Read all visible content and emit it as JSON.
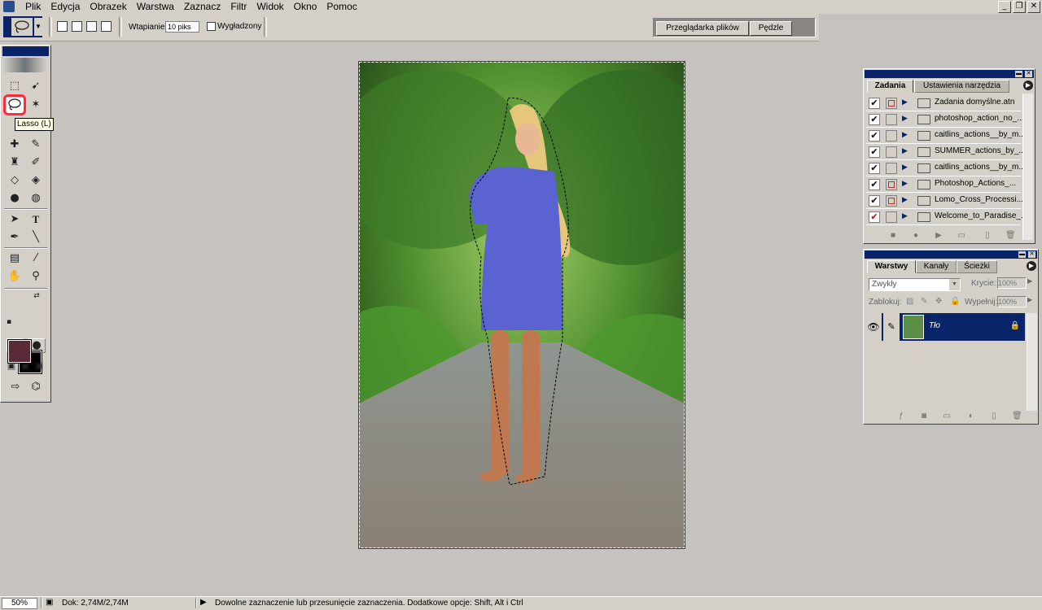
{
  "menubar": {
    "items": [
      "Plik",
      "Edycja",
      "Obrazek",
      "Warstwa",
      "Zaznacz",
      "Filtr",
      "Widok",
      "Okno",
      "Pomoc"
    ],
    "window_buttons": [
      "_",
      "❐",
      "✕"
    ]
  },
  "options_bar": {
    "feather_label": "Wtapianie",
    "feather_value": "10 piks",
    "antialias_label": "Wygładzony",
    "well_tabs": [
      "Przeglądarka plików",
      "Pędzle"
    ]
  },
  "toolbox": {
    "tooltip": "Lasso (L)",
    "fg_color": "#5a2a36",
    "bg_color": "#000000"
  },
  "actions_panel": {
    "tabs": [
      "Zadania",
      "Ustawienia narzędzia"
    ],
    "rows": [
      {
        "label": "Zadania domyślne.atn",
        "checked": true,
        "dialog": true
      },
      {
        "label": "photoshop_action_no_...",
        "checked": true,
        "dialog": false
      },
      {
        "label": "caitlins_actions__by_m...",
        "checked": true,
        "dialog": false
      },
      {
        "label": "SUMMER_actions_by_...",
        "checked": true,
        "dialog": false
      },
      {
        "label": "caitlins_actions__by_m...",
        "checked": true,
        "dialog": false
      },
      {
        "label": "Photoshop_Actions_...",
        "checked": true,
        "dialog": true
      },
      {
        "label": "Lomo_Cross_Processi...",
        "checked": true,
        "dialog": true
      },
      {
        "label": "Welcome_to_Paradise_...",
        "checked": true,
        "dialog": false,
        "red": true
      }
    ]
  },
  "layers_panel": {
    "tabs": [
      "Warstwy",
      "Kanały",
      "Ścieżki"
    ],
    "blend_mode": "Zwykły",
    "opacity_label": "Krycie:",
    "opacity_value": "100%",
    "lock_label": "Zablokuj:",
    "fill_label": "Wypełnij:",
    "fill_value": "100%",
    "layer_name": "Tło"
  },
  "statusbar": {
    "zoom": "50%",
    "doc_info": "Dok: 2,74M/2,74M",
    "hint": "Dowolne zaznaczenie lub przesunięcie zaznaczenia. Dodatkowe opcje: Shift, Alt i Ctrl"
  }
}
